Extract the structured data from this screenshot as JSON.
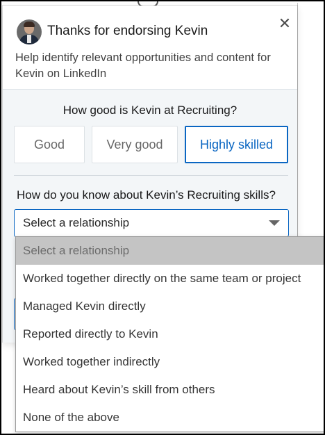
{
  "modal": {
    "title": "Thanks for endorsing Kevin",
    "subtitle": "Help identify relevant opportunities and content for Kevin on LinkedIn",
    "close_glyph": "✕",
    "avatar_icon": "profile-photo"
  },
  "skill_rating": {
    "question": "How good is Kevin at Recruiting?",
    "options": [
      {
        "label": "Good",
        "selected": false
      },
      {
        "label": "Very good",
        "selected": false
      },
      {
        "label": "Highly skilled",
        "selected": true
      }
    ]
  },
  "relationship": {
    "question": "How do you know about Kevin’s Recruiting skills?",
    "selected_value": "Select a relationship",
    "caret_icon": "caret-down-icon",
    "options": [
      "Select a relationship",
      "Worked together directly on the same team or project",
      "Managed Kevin directly",
      "Reported directly to Kevin",
      "Worked together indirectly",
      "Heard about Kevin’s skill from others",
      "None of the above"
    ]
  },
  "colors": {
    "accent": "#0a66c2",
    "panel_background": "#f3f6f8",
    "dropdown_highlight": "#c4c4c4"
  }
}
